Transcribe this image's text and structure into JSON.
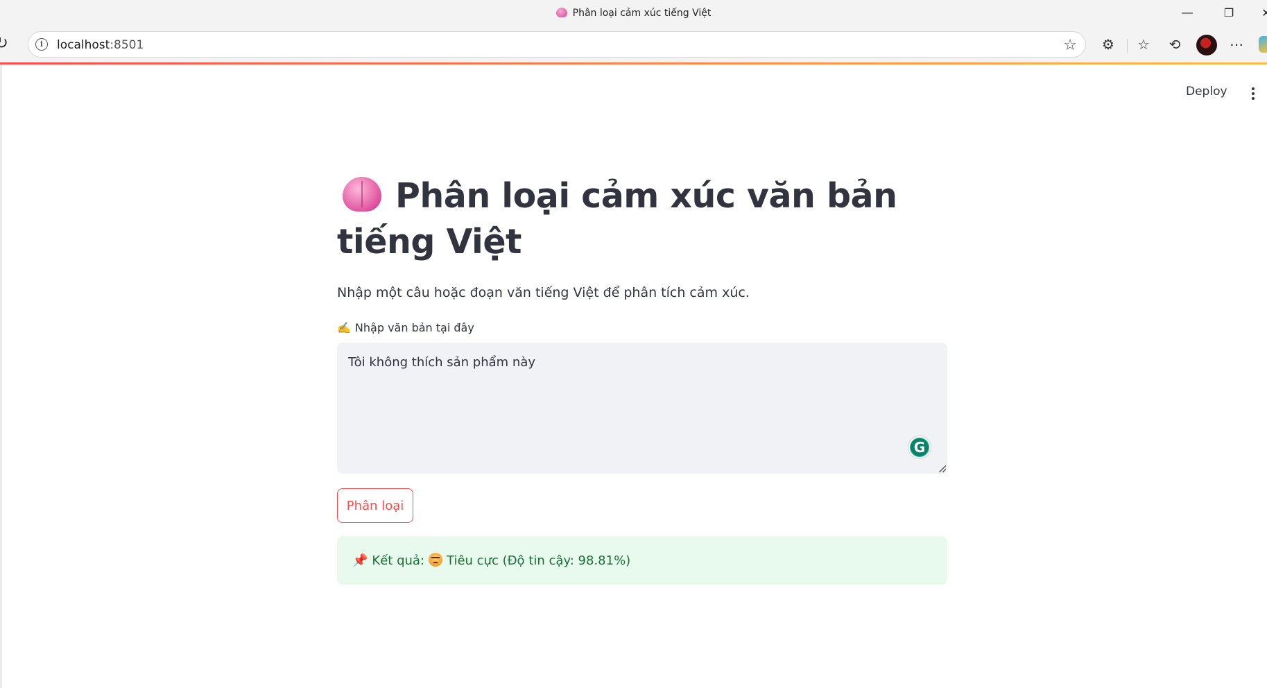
{
  "browser": {
    "tab_title": "Phân loại cảm xúc tiếng Việt",
    "url_host": "localhost",
    "url_port": ":8501",
    "window_controls": {
      "minimize": "—",
      "restore": "❐",
      "close": "✕"
    },
    "toolbar_icons": [
      "extensions-icon",
      "favorites-icon",
      "history-icon",
      "profile-avatar",
      "more-icon"
    ]
  },
  "app": {
    "deploy_label": "Deploy",
    "title": "Phân loại cảm xúc văn bản tiếng Việt",
    "subtitle": "Nhập một câu hoặc đoạn văn tiếng Việt để phân tích cảm xúc.",
    "input_label_emoji": "✍️",
    "input_label": "Nhập văn bản tại đây",
    "input_value": "Tôi không thích sản phẩm này",
    "classify_button": "Phân loại",
    "result_emoji": "📌",
    "result_prefix": "Kết quả:",
    "result_text": "Tiêu cực (Độ tin cậy: 98.81%)",
    "result_sentiment_icon": "angry-face-icon"
  },
  "colors": {
    "accent": "#ff4b4b",
    "success_bg": "#e8f9ee",
    "success_text": "#177233",
    "input_bg": "#f0f2f6"
  }
}
